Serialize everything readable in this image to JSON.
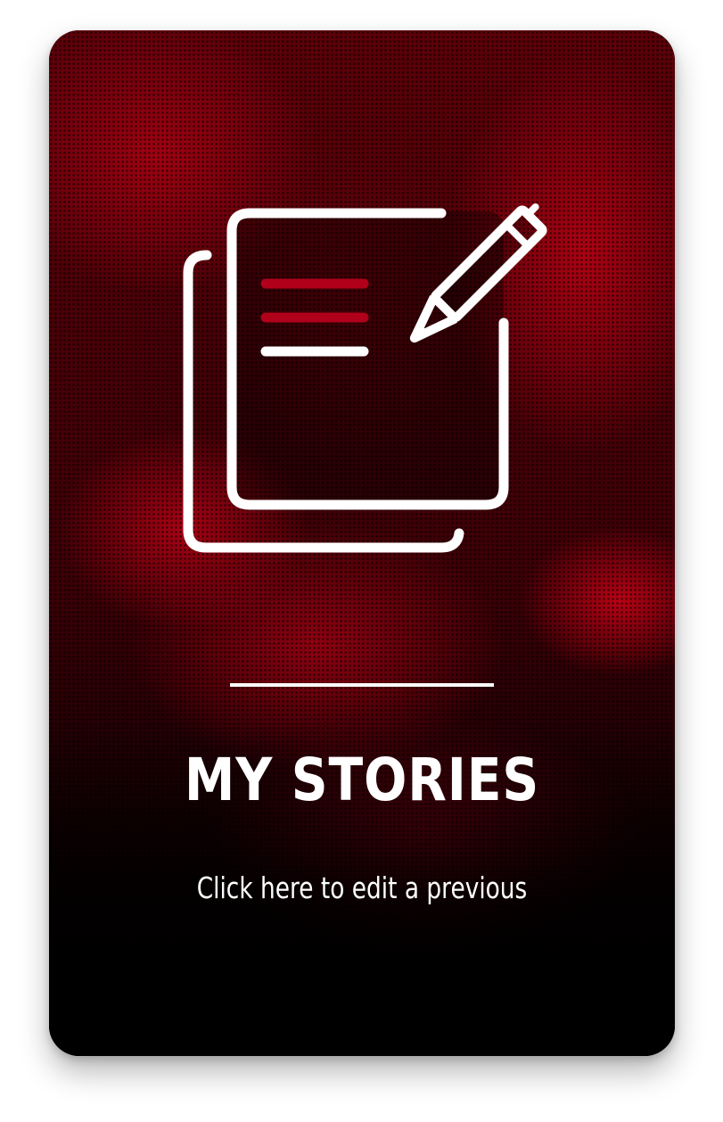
{
  "card": {
    "title": "MY STORIES",
    "subtitle": "Click here to edit a previous",
    "icon": "document-edit-icon"
  },
  "colors": {
    "accent": "#b0001a",
    "text": "#ffffff"
  }
}
